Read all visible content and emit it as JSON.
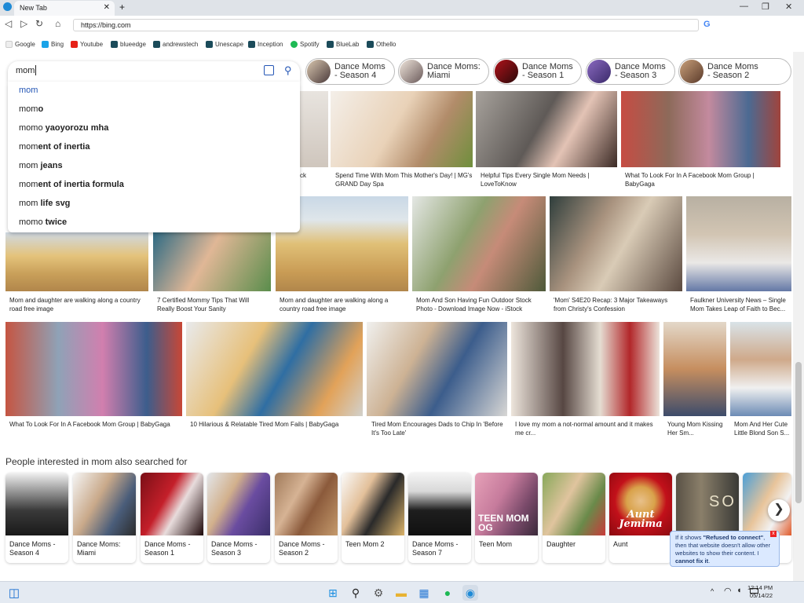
{
  "browser": {
    "tab_title": "New Tab",
    "url": "https://bing.com",
    "search_engine_icon": "G",
    "bookmarks": [
      "Google",
      "Bing",
      "Youtube",
      "blueedge",
      "andrewstech",
      "Unescape",
      "Inception",
      "Spotify",
      "BlueLab",
      "Othello"
    ]
  },
  "search": {
    "query": "mom",
    "suggestions": [
      {
        "typed": "mom",
        "rest": ""
      },
      {
        "typed": "mom",
        "rest": "o"
      },
      {
        "typed": "momo ",
        "rest": "yaoyorozu mha"
      },
      {
        "typed": "mom",
        "rest": "ent of inertia"
      },
      {
        "typed": "mom ",
        "rest": "jeans"
      },
      {
        "typed": "mom",
        "rest": "ent of inertia formula"
      },
      {
        "typed": "mom ",
        "rest": "life svg"
      },
      {
        "typed": "momo ",
        "rest": "twice"
      }
    ]
  },
  "related_pills": [
    {
      "l1": "Dance Moms",
      "l2": "- Season 4"
    },
    {
      "l1": "Dance Moms:",
      "l2": "Miami"
    },
    {
      "l1": "Dance Moms",
      "l2": "- Season 1"
    },
    {
      "l1": "Dance Moms",
      "l2": "- Season 3"
    },
    {
      "l1": "Dance Moms",
      "l2": "- Season 2"
    }
  ],
  "row1_captions": [
    "ck",
    "Spend Time With Mom This Mother's Day! | MG's GRAND Day Spa",
    "Helpful Tips Every Single Mom Needs | LoveToKnow",
    "What To Look For In A Facebook Mom Group | BabyGaga"
  ],
  "row2_captions": [
    "Mom and daughter are walking along a country road free image",
    "7 Certified Mommy Tips That Will Really Boost Your Sanity",
    "Mom and daughter are walking along a country road free image",
    "Mom And Son Having Fun Outdoor Stock Photo - Download Image Now - iStock",
    "'Mom' S4E20 Recap: 3 Major Takeaways from Christy's Confession",
    "Faulkner University News – Single Mom Takes Leap of Faith to Bec..."
  ],
  "row3_captions": [
    "What To Look For In A Facebook Mom Group | BabyGaga",
    "10 Hilarious & Relatable Tired Mom Fails | BabyGaga",
    "Tired Mom Encourages Dads to Chip In 'Before It's Too Late'",
    "I love my mom a not-normal amount and it makes me cr...",
    "Young Mom Kissing Her Sm...",
    "Mom And Her Cute Little Blond Son S..."
  ],
  "people_title": "People interested in mom also searched for",
  "people_cards": [
    {
      "l1": "Dance Moms -",
      "l2": "Season 4"
    },
    {
      "l1": "Dance Moms:",
      "l2": "Miami"
    },
    {
      "l1": "Dance Moms -",
      "l2": "Season 1"
    },
    {
      "l1": "Dance Moms -",
      "l2": "Season 3"
    },
    {
      "l1": "Dance Moms -",
      "l2": "Season 2"
    },
    {
      "l1": "Teen Mom 2",
      "l2": ""
    },
    {
      "l1": "Dance Moms -",
      "l2": "Season 7"
    },
    {
      "l1": "Teen Mom",
      "l2": ""
    },
    {
      "l1": "Daughter",
      "l2": ""
    },
    {
      "l1": "Aunt",
      "l2": ""
    },
    {
      "l1": "",
      "l2": ""
    },
    {
      "l1": "",
      "l2": ""
    }
  ],
  "card_art": {
    "aunt_jemima": "Aunt Jemima",
    "teen_mom": "TEEN MOM OG",
    "show_letters": "SO"
  },
  "tooltip": {
    "pre": "If it shows ",
    "b1": "\"Refused to connect\"",
    "mid": ", then that website doesn't allow other websites to show their content. I ",
    "b2": "cannot fix it",
    "end": "."
  },
  "taskbar": {
    "time": "12:14 PM",
    "date": "05/14/22"
  },
  "colors": {
    "accent": "#0078d4",
    "bing_blue": "#174ae4"
  }
}
